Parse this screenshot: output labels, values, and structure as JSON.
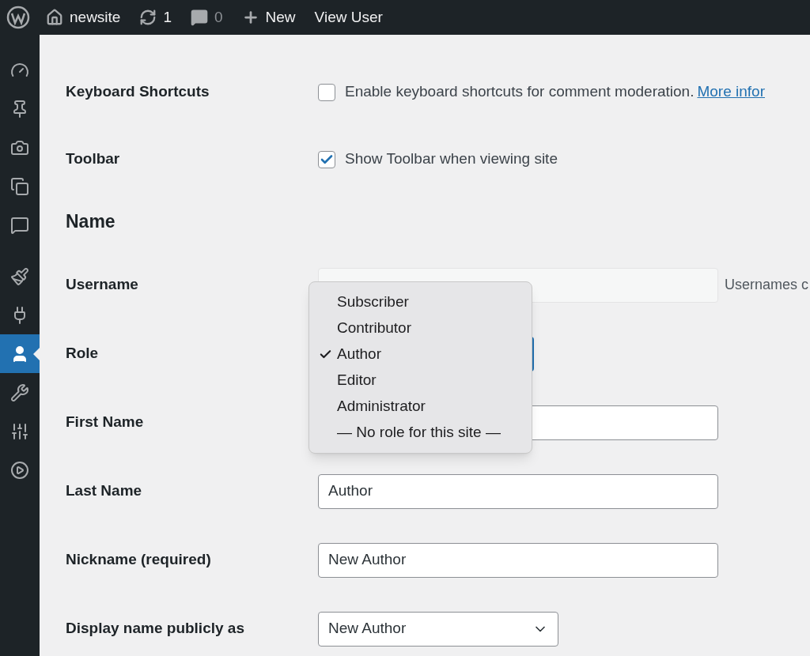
{
  "toolbar": {
    "items": [
      {
        "kind": "logo"
      },
      {
        "kind": "home",
        "label": "newsite"
      },
      {
        "kind": "updates",
        "label": "1"
      },
      {
        "kind": "comments",
        "label": "0"
      },
      {
        "kind": "new",
        "label": "New"
      },
      {
        "kind": "link",
        "label": "View User"
      }
    ]
  },
  "sidebar": {
    "items": [
      {
        "kind": "dashboard",
        "selected": false
      },
      {
        "kind": "posts",
        "selected": false
      },
      {
        "kind": "media",
        "selected": false
      },
      {
        "kind": "pages",
        "selected": false
      },
      {
        "kind": "comments",
        "selected": false
      },
      {
        "kind": "appearance",
        "selected": false
      },
      {
        "kind": "plugins",
        "selected": false
      },
      {
        "kind": "users",
        "selected": true
      },
      {
        "kind": "tools",
        "selected": false
      },
      {
        "kind": "settings",
        "selected": false
      },
      {
        "kind": "media-player",
        "selected": false
      }
    ]
  },
  "form": {
    "rows": [
      {
        "kind": "checkbox",
        "label": "Keyboard Shortcuts",
        "text": "Enable keyboard shortcuts for comment moderation.",
        "link": "More infor",
        "checked": false
      },
      {
        "kind": "checkbox",
        "label": "Toolbar",
        "text": "Show Toolbar when viewing site",
        "checked": true
      },
      {
        "kind": "heading",
        "label": "Name"
      },
      {
        "kind": "text",
        "label": "Username",
        "disabled": true,
        "description": "Usernames c"
      },
      {
        "kind": "role",
        "label": "Role"
      },
      {
        "kind": "text",
        "label": "First Name",
        "disabled": false
      },
      {
        "kind": "text",
        "label": "Last Name",
        "value": "Author",
        "disabled": false
      },
      {
        "kind": "text",
        "label": "Nickname (required)",
        "value": "New Author",
        "disabled": false
      },
      {
        "kind": "select",
        "label": "Display name publicly as",
        "value": "New Author"
      }
    ]
  },
  "role_menu": {
    "options": [
      {
        "label": "Subscriber",
        "selected": false
      },
      {
        "label": "Contributor",
        "selected": false
      },
      {
        "label": "Author",
        "selected": true
      },
      {
        "label": "Editor",
        "selected": false
      },
      {
        "label": "Administrator",
        "selected": false
      },
      {
        "label": "— No role for this site —",
        "selected": false
      }
    ]
  }
}
